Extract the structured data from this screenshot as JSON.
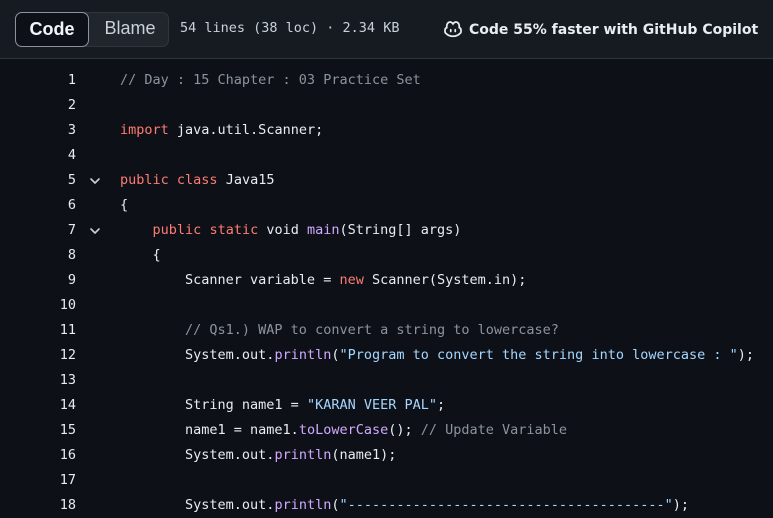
{
  "toolbar": {
    "code_tab": "Code",
    "blame_tab": "Blame",
    "file_info": "54 lines (38 loc) · 2.34 KB",
    "copilot_label": "Code 55% faster with GitHub Copilot"
  },
  "colors": {
    "background": "#0d1117",
    "toolbar": "#161b22",
    "keyword": "#ff7b72",
    "string": "#a5d6ff",
    "comment": "#8b949e",
    "function": "#d2a8ff"
  },
  "code": {
    "lines": [
      {
        "num": "1",
        "fold": false,
        "tokens": [
          {
            "t": "// Day : 15 Chapter : 03 Practice Set",
            "c": "comment"
          }
        ]
      },
      {
        "num": "2",
        "fold": false,
        "tokens": []
      },
      {
        "num": "3",
        "fold": false,
        "tokens": [
          {
            "t": "import",
            "c": "keyword"
          },
          {
            "t": " java.util.Scanner;",
            "c": "plain"
          }
        ]
      },
      {
        "num": "4",
        "fold": false,
        "tokens": []
      },
      {
        "num": "5",
        "fold": true,
        "tokens": [
          {
            "t": "public",
            "c": "keyword"
          },
          {
            "t": " ",
            "c": "plain"
          },
          {
            "t": "class",
            "c": "keyword"
          },
          {
            "t": " Java15",
            "c": "plain"
          }
        ]
      },
      {
        "num": "6",
        "fold": false,
        "tokens": [
          {
            "t": "{",
            "c": "plain"
          }
        ]
      },
      {
        "num": "7",
        "fold": true,
        "tokens": [
          {
            "t": "    ",
            "c": "plain"
          },
          {
            "t": "public",
            "c": "keyword"
          },
          {
            "t": " ",
            "c": "plain"
          },
          {
            "t": "static",
            "c": "keyword"
          },
          {
            "t": " void ",
            "c": "plain"
          },
          {
            "t": "main",
            "c": "func"
          },
          {
            "t": "(String[] args)",
            "c": "plain"
          }
        ]
      },
      {
        "num": "8",
        "fold": false,
        "tokens": [
          {
            "t": "    {",
            "c": "plain"
          }
        ]
      },
      {
        "num": "9",
        "fold": false,
        "tokens": [
          {
            "t": "        Scanner variable = ",
            "c": "plain"
          },
          {
            "t": "new",
            "c": "keyword"
          },
          {
            "t": " Scanner(System.in);",
            "c": "plain"
          }
        ]
      },
      {
        "num": "10",
        "fold": false,
        "tokens": []
      },
      {
        "num": "11",
        "fold": false,
        "tokens": [
          {
            "t": "        // Qs1.) WAP to convert a string to lowercase?",
            "c": "comment"
          }
        ]
      },
      {
        "num": "12",
        "fold": false,
        "tokens": [
          {
            "t": "        System.out.",
            "c": "plain"
          },
          {
            "t": "println",
            "c": "method"
          },
          {
            "t": "(",
            "c": "plain"
          },
          {
            "t": "\"Program to convert the string into lowercase : \"",
            "c": "string"
          },
          {
            "t": ");",
            "c": "plain"
          }
        ]
      },
      {
        "num": "13",
        "fold": false,
        "tokens": []
      },
      {
        "num": "14",
        "fold": false,
        "tokens": [
          {
            "t": "        String name1 = ",
            "c": "plain"
          },
          {
            "t": "\"KARAN VEER PAL\"",
            "c": "string"
          },
          {
            "t": ";",
            "c": "plain"
          }
        ]
      },
      {
        "num": "15",
        "fold": false,
        "tokens": [
          {
            "t": "        name1 = name1.",
            "c": "plain"
          },
          {
            "t": "toLowerCase",
            "c": "method"
          },
          {
            "t": "(); ",
            "c": "plain"
          },
          {
            "t": "// Update Variable",
            "c": "comment"
          }
        ]
      },
      {
        "num": "16",
        "fold": false,
        "tokens": [
          {
            "t": "        System.out.",
            "c": "plain"
          },
          {
            "t": "println",
            "c": "method"
          },
          {
            "t": "(name1);",
            "c": "plain"
          }
        ]
      },
      {
        "num": "17",
        "fold": false,
        "tokens": []
      },
      {
        "num": "18",
        "fold": false,
        "tokens": [
          {
            "t": "        System.out.",
            "c": "plain"
          },
          {
            "t": "println",
            "c": "method"
          },
          {
            "t": "(",
            "c": "plain"
          },
          {
            "t": "\"---------------------------------------\"",
            "c": "string"
          },
          {
            "t": ");",
            "c": "plain"
          }
        ]
      }
    ]
  }
}
